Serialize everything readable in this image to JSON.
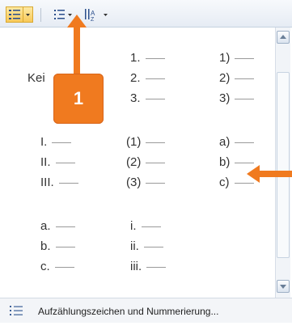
{
  "toolbar": {
    "bullets_button": "bullets-list",
    "multilevel_button": "multilevel-list",
    "sort_button": "sort"
  },
  "gallery": {
    "none_label": "Kei",
    "rows": [
      [
        "",
        "1.",
        "1)"
      ],
      [
        "Kei",
        "2.",
        "2)"
      ],
      [
        "",
        "3.",
        "3)"
      ],
      [
        "I.",
        "(1)",
        "a)"
      ],
      [
        "II.",
        "(2)",
        "b)"
      ],
      [
        "III.",
        "(3)",
        "c)"
      ],
      [
        "a.",
        "i.",
        ""
      ],
      [
        "b.",
        "ii.",
        ""
      ],
      [
        "c.",
        "iii.",
        ""
      ]
    ],
    "entries": {
      "arabic_dot": [
        "1.",
        "2.",
        "3."
      ],
      "arabic_paren": [
        "1)",
        "2)",
        "3)"
      ],
      "roman_upper": [
        "I.",
        "II.",
        "III."
      ],
      "arabic_parens_both": [
        "(1)",
        "(2)",
        "(3)"
      ],
      "alpha_paren": [
        "a)",
        "b)",
        "c)"
      ],
      "alpha_dot": [
        "a.",
        "b.",
        "c."
      ],
      "roman_lower": [
        "i.",
        "ii.",
        "iii."
      ]
    }
  },
  "footer": {
    "label": "Aufzählungszeichen und Nummerierung..."
  },
  "annotation": {
    "badge": "1",
    "color": "#f07a1f"
  }
}
